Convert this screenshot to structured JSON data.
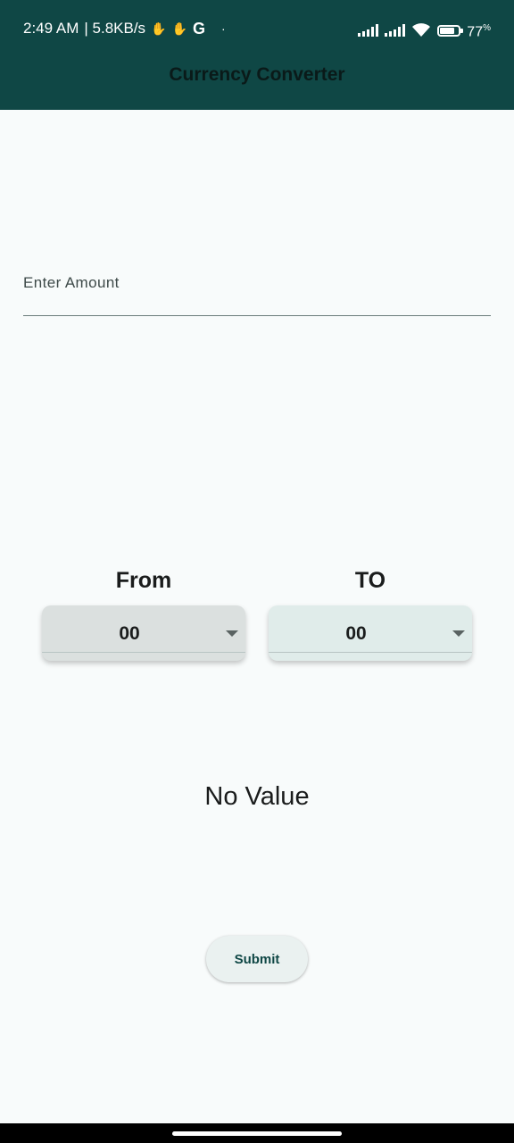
{
  "status_bar": {
    "time": "2:49 AM",
    "network_speed": "| 5.8KB/s",
    "g_label": "G",
    "dot": "·",
    "battery_percent": "77",
    "battery_unit": "%",
    "battery_level": 0.77
  },
  "app_bar": {
    "title": "Currency Converter",
    "background": "#0f4745"
  },
  "amount_field": {
    "value": "",
    "placeholder": "Enter Amount"
  },
  "from": {
    "label": "From",
    "selected": "00"
  },
  "to": {
    "label": "TO",
    "selected": "00"
  },
  "result": {
    "text": "No Value"
  },
  "submit": {
    "label": "Submit"
  },
  "colors": {
    "accent": "#0f4745",
    "background": "#f8fbfb",
    "from_dropdown": "#dbe0df",
    "to_dropdown": "#e0ecea"
  }
}
